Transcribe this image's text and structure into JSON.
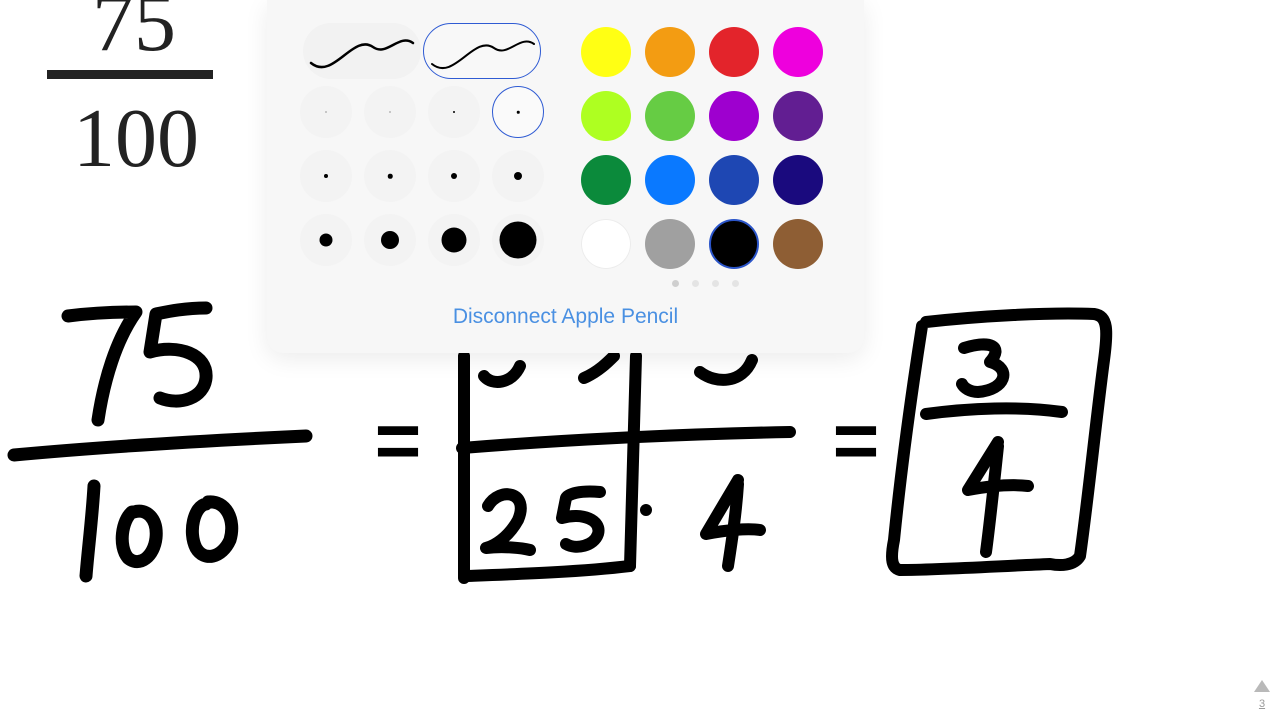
{
  "canvas": {
    "printed_fraction": {
      "numerator": "75",
      "denominator": "100"
    },
    "handwriting": {
      "left_fraction": {
        "numerator": "75",
        "denominator": "100"
      },
      "middle_fraction": {
        "numerator_hidden": "25 · 3",
        "denominator": "25 · 4",
        "equals": "="
      },
      "boxed_fraction": {
        "numerator": "3",
        "denominator": "4",
        "equals": "="
      }
    }
  },
  "pen_palette": {
    "stroke_styles": [
      {
        "name": "smooth-curve-stroke",
        "selected": false
      },
      {
        "name": "tapered-curve-stroke",
        "selected": true
      }
    ],
    "sizes": [
      {
        "dot": 1,
        "selected": false
      },
      {
        "dot": 1,
        "selected": false
      },
      {
        "dot": 2,
        "selected": false
      },
      {
        "dot": 2.5,
        "selected": true
      },
      {
        "dot": 4,
        "selected": false
      },
      {
        "dot": 4.5,
        "selected": false
      },
      {
        "dot": 6,
        "selected": false
      },
      {
        "dot": 8,
        "selected": false
      },
      {
        "dot": 13,
        "selected": false
      },
      {
        "dot": 18,
        "selected": false
      },
      {
        "dot": 25,
        "selected": false
      },
      {
        "dot": 37,
        "selected": false
      }
    ],
    "colors": [
      {
        "name": "yellow",
        "hex": "#ffff14"
      },
      {
        "name": "orange",
        "hex": "#f39c12"
      },
      {
        "name": "red",
        "hex": "#e3242b"
      },
      {
        "name": "magenta",
        "hex": "#ee00dd"
      },
      {
        "name": "lime",
        "hex": "#aeff21"
      },
      {
        "name": "green",
        "hex": "#66cc44"
      },
      {
        "name": "purple",
        "hex": "#9e00cf"
      },
      {
        "name": "dark-purple",
        "hex": "#621e92"
      },
      {
        "name": "dark-green",
        "hex": "#0b8a3b"
      },
      {
        "name": "blue",
        "hex": "#0a79ff"
      },
      {
        "name": "royal-blue",
        "hex": "#1e47b3"
      },
      {
        "name": "navy",
        "hex": "#1a0a7e"
      },
      {
        "name": "white",
        "hex": "#ffffff"
      },
      {
        "name": "gray",
        "hex": "#a0a0a0"
      },
      {
        "name": "black",
        "hex": "#000000",
        "selected": true
      },
      {
        "name": "brown",
        "hex": "#8e5e34"
      }
    ],
    "page_count": 4,
    "active_page": 1,
    "disconnect_label": "Disconnect Apple Pencil"
  },
  "page_indicator": {
    "number": "3"
  }
}
